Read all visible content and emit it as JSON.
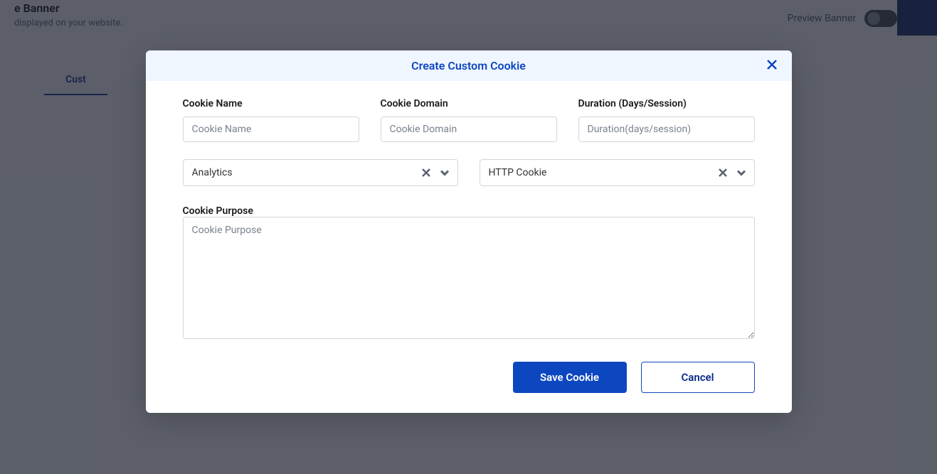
{
  "background": {
    "title": "e Banner",
    "subtitle": "displayed on your website.",
    "preview_label": "Preview Banner",
    "tab_label": "Cust"
  },
  "modal": {
    "title": "Create Custom Cookie",
    "fields": {
      "cookie_name": {
        "label": "Cookie Name",
        "placeholder": "Cookie Name",
        "value": ""
      },
      "cookie_domain": {
        "label": "Cookie Domain",
        "placeholder": "Cookie Domain",
        "value": ""
      },
      "duration": {
        "label": "Duration (Days/Session)",
        "placeholder": "Duration(days/session)",
        "value": ""
      },
      "category_select": {
        "value": "Analytics"
      },
      "type_select": {
        "value": "HTTP Cookie"
      },
      "purpose": {
        "label": "Cookie Purpose",
        "placeholder": "Cookie Purpose",
        "value": ""
      }
    },
    "buttons": {
      "save": "Save Cookie",
      "cancel": "Cancel"
    }
  }
}
